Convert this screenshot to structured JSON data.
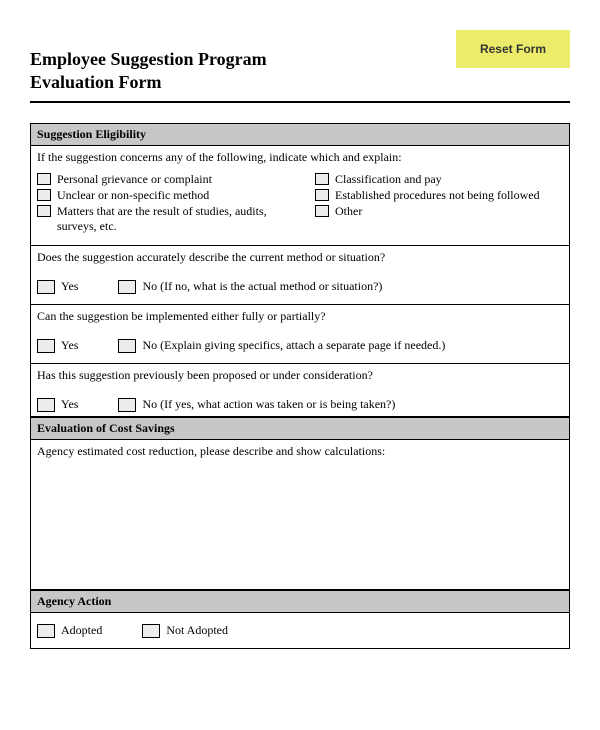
{
  "header": {
    "title_line1": "Employee Suggestion Program",
    "title_line2": "Evaluation Form",
    "reset_button": "Reset Form"
  },
  "section_eligibility": {
    "header": "Suggestion Eligibility",
    "intro": "If the suggestion concerns any of the following, indicate which and explain:",
    "left_items": [
      "Personal grievance or complaint",
      "Unclear or non-specific method",
      "Matters that are the result of studies, audits, surveys, etc."
    ],
    "right_items": [
      "Classification and pay",
      "Established procedures not being followed",
      "Other"
    ]
  },
  "question1": {
    "text": "Does the suggestion accurately describe the current method or situation?",
    "yes": "Yes",
    "no": "No  (If no, what is the actual method or situation?)"
  },
  "question2": {
    "text": "Can the suggestion be implemented either fully or partially?",
    "yes": "Yes",
    "no": "No  (Explain giving specifics, attach a separate page if needed.)"
  },
  "question3": {
    "text": "Has this suggestion previously been proposed or under consideration?",
    "yes": "Yes",
    "no": "No  (If yes, what action was taken or is being taken?)"
  },
  "section_cost": {
    "header": "Evaluation of Cost Savings",
    "intro": "Agency estimated cost reduction, please describe and show calculations:"
  },
  "section_action": {
    "header": "Agency Action",
    "adopted": "Adopted",
    "not_adopted": "Not Adopted"
  }
}
